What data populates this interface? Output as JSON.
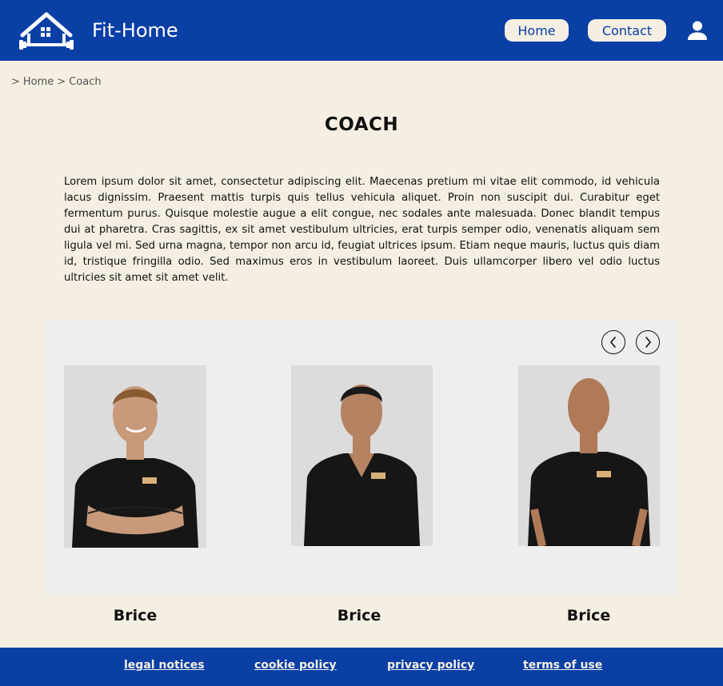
{
  "header": {
    "brand": "Fit-Home",
    "nav": {
      "home_label": "Home",
      "contact_label": "Contact"
    },
    "logo_icon": "house-dumbbell-logo-icon",
    "user_icon": "user-account-icon"
  },
  "breadcrumb": {
    "sep1": ">",
    "home": "Home",
    "sep2": ">",
    "current": "Coach"
  },
  "page": {
    "title": "COACH",
    "intro": "Lorem ipsum dolor sit amet, consectetur adipiscing elit. Maecenas pretium mi vitae elit commodo, id vehicula lacus dignissim. Praesent mattis turpis quis tellus vehicula aliquet. Proin non suscipit dui. Curabitur eget fermentum purus. Quisque molestie augue a elit congue, nec sodales ante malesuada. Donec blandit tempus dui at pharetra. Cras sagittis, ex sit amet vestibulum ultricies, erat turpis semper odio, venenatis aliquam sem ligula vel mi. Sed urna magna, tempor non arcu id, feugiat ultrices ipsum. Etiam neque mauris, luctus quis diam id, tristique fringilla odio. Sed maximus eros in vestibulum laoreet. Duis ullamcorper libero vel odio luctus ultricies sit amet sit amet velit."
  },
  "carousel": {
    "prev_icon": "chevron-left-icon",
    "next_icon": "chevron-right-icon",
    "coaches": [
      {
        "name": "Brice"
      },
      {
        "name": "Brice"
      },
      {
        "name": "Brice"
      }
    ]
  },
  "footer": {
    "links": [
      "legal notices",
      "cookie policy",
      "privacy policy",
      "terms of use"
    ]
  },
  "colors": {
    "primary": "#0a3fa6",
    "background": "#f5efe3",
    "carousel_bg": "#eeeeee"
  }
}
